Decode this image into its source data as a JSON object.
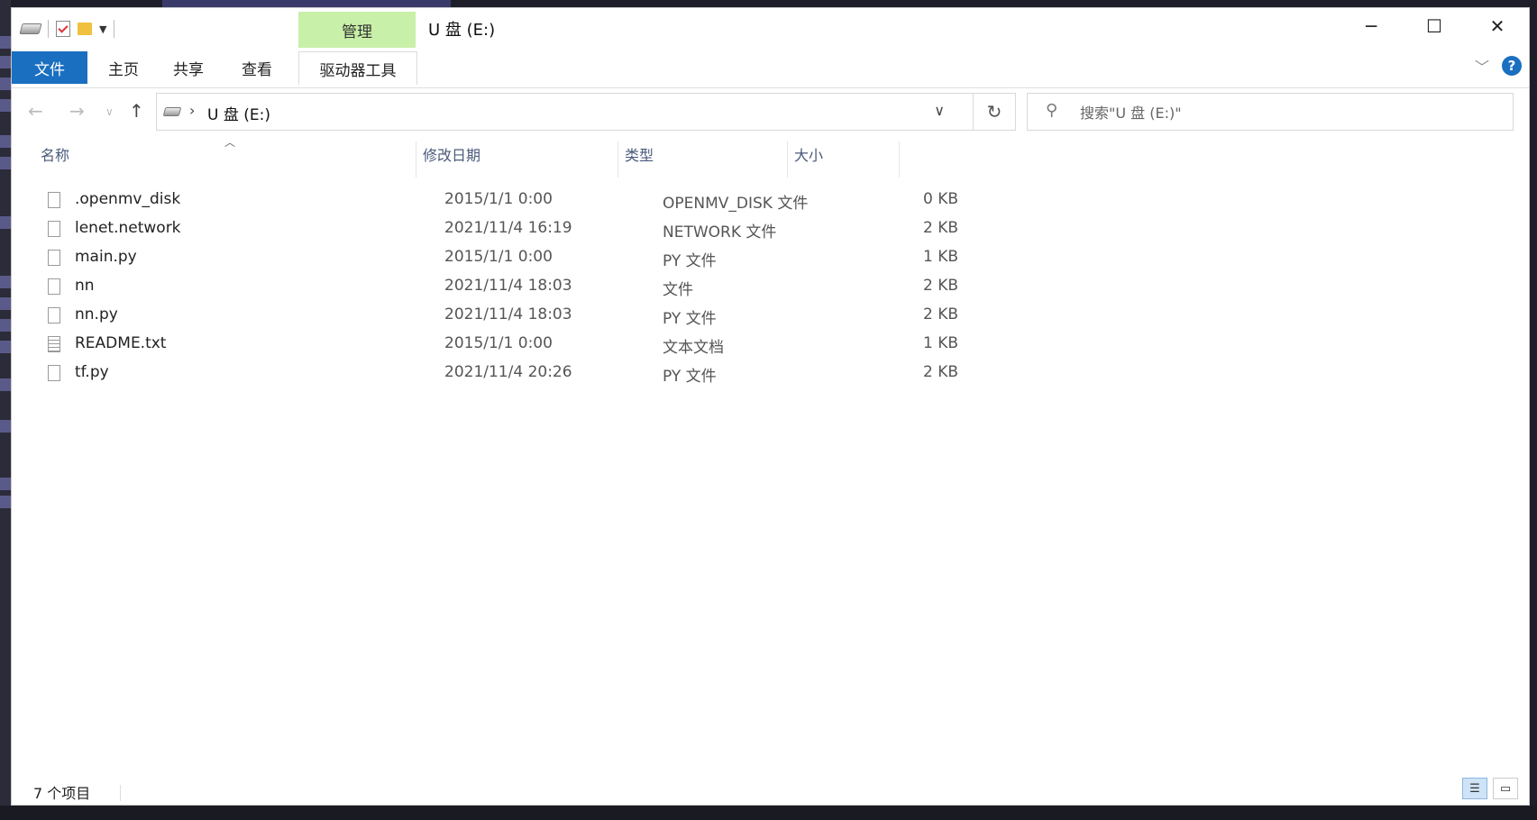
{
  "window": {
    "title": "U 盘 (E:)",
    "manage_tab": "管理"
  },
  "ribbon": {
    "tabs": [
      "文件",
      "主页",
      "共享",
      "查看",
      "驱动器工具"
    ]
  },
  "nav": {
    "crumb": "U 盘 (E:)",
    "search_placeholder": "搜索\"U 盘 (E:)\""
  },
  "columns": {
    "name": "名称",
    "date": "修改日期",
    "type": "类型",
    "size": "大小"
  },
  "files": [
    {
      "name": ".openmv_disk",
      "date": "2015/1/1 0:00",
      "type": "OPENMV_DISK 文件",
      "size": "0 KB",
      "icon": "file-icon"
    },
    {
      "name": "lenet.network",
      "date": "2021/11/4 16:19",
      "type": "NETWORK 文件",
      "size": "2 KB",
      "icon": "file-icon"
    },
    {
      "name": "main.py",
      "date": "2015/1/1 0:00",
      "type": "PY 文件",
      "size": "1 KB",
      "icon": "file-icon"
    },
    {
      "name": "nn",
      "date": "2021/11/4 18:03",
      "type": "文件",
      "size": "2 KB",
      "icon": "file-icon"
    },
    {
      "name": "nn.py",
      "date": "2021/11/4 18:03",
      "type": "PY 文件",
      "size": "2 KB",
      "icon": "file-icon"
    },
    {
      "name": "README.txt",
      "date": "2015/1/1 0:00",
      "type": "文本文档",
      "size": "1 KB",
      "icon": "text-document-icon"
    },
    {
      "name": "tf.py",
      "date": "2021/11/4 20:26",
      "type": "PY 文件",
      "size": "2 KB",
      "icon": "file-icon"
    }
  ],
  "status": {
    "item_count": "7 个项目"
  },
  "colors": {
    "accent": "#1a6fc0",
    "manage_tab": "#c8f0a8"
  }
}
